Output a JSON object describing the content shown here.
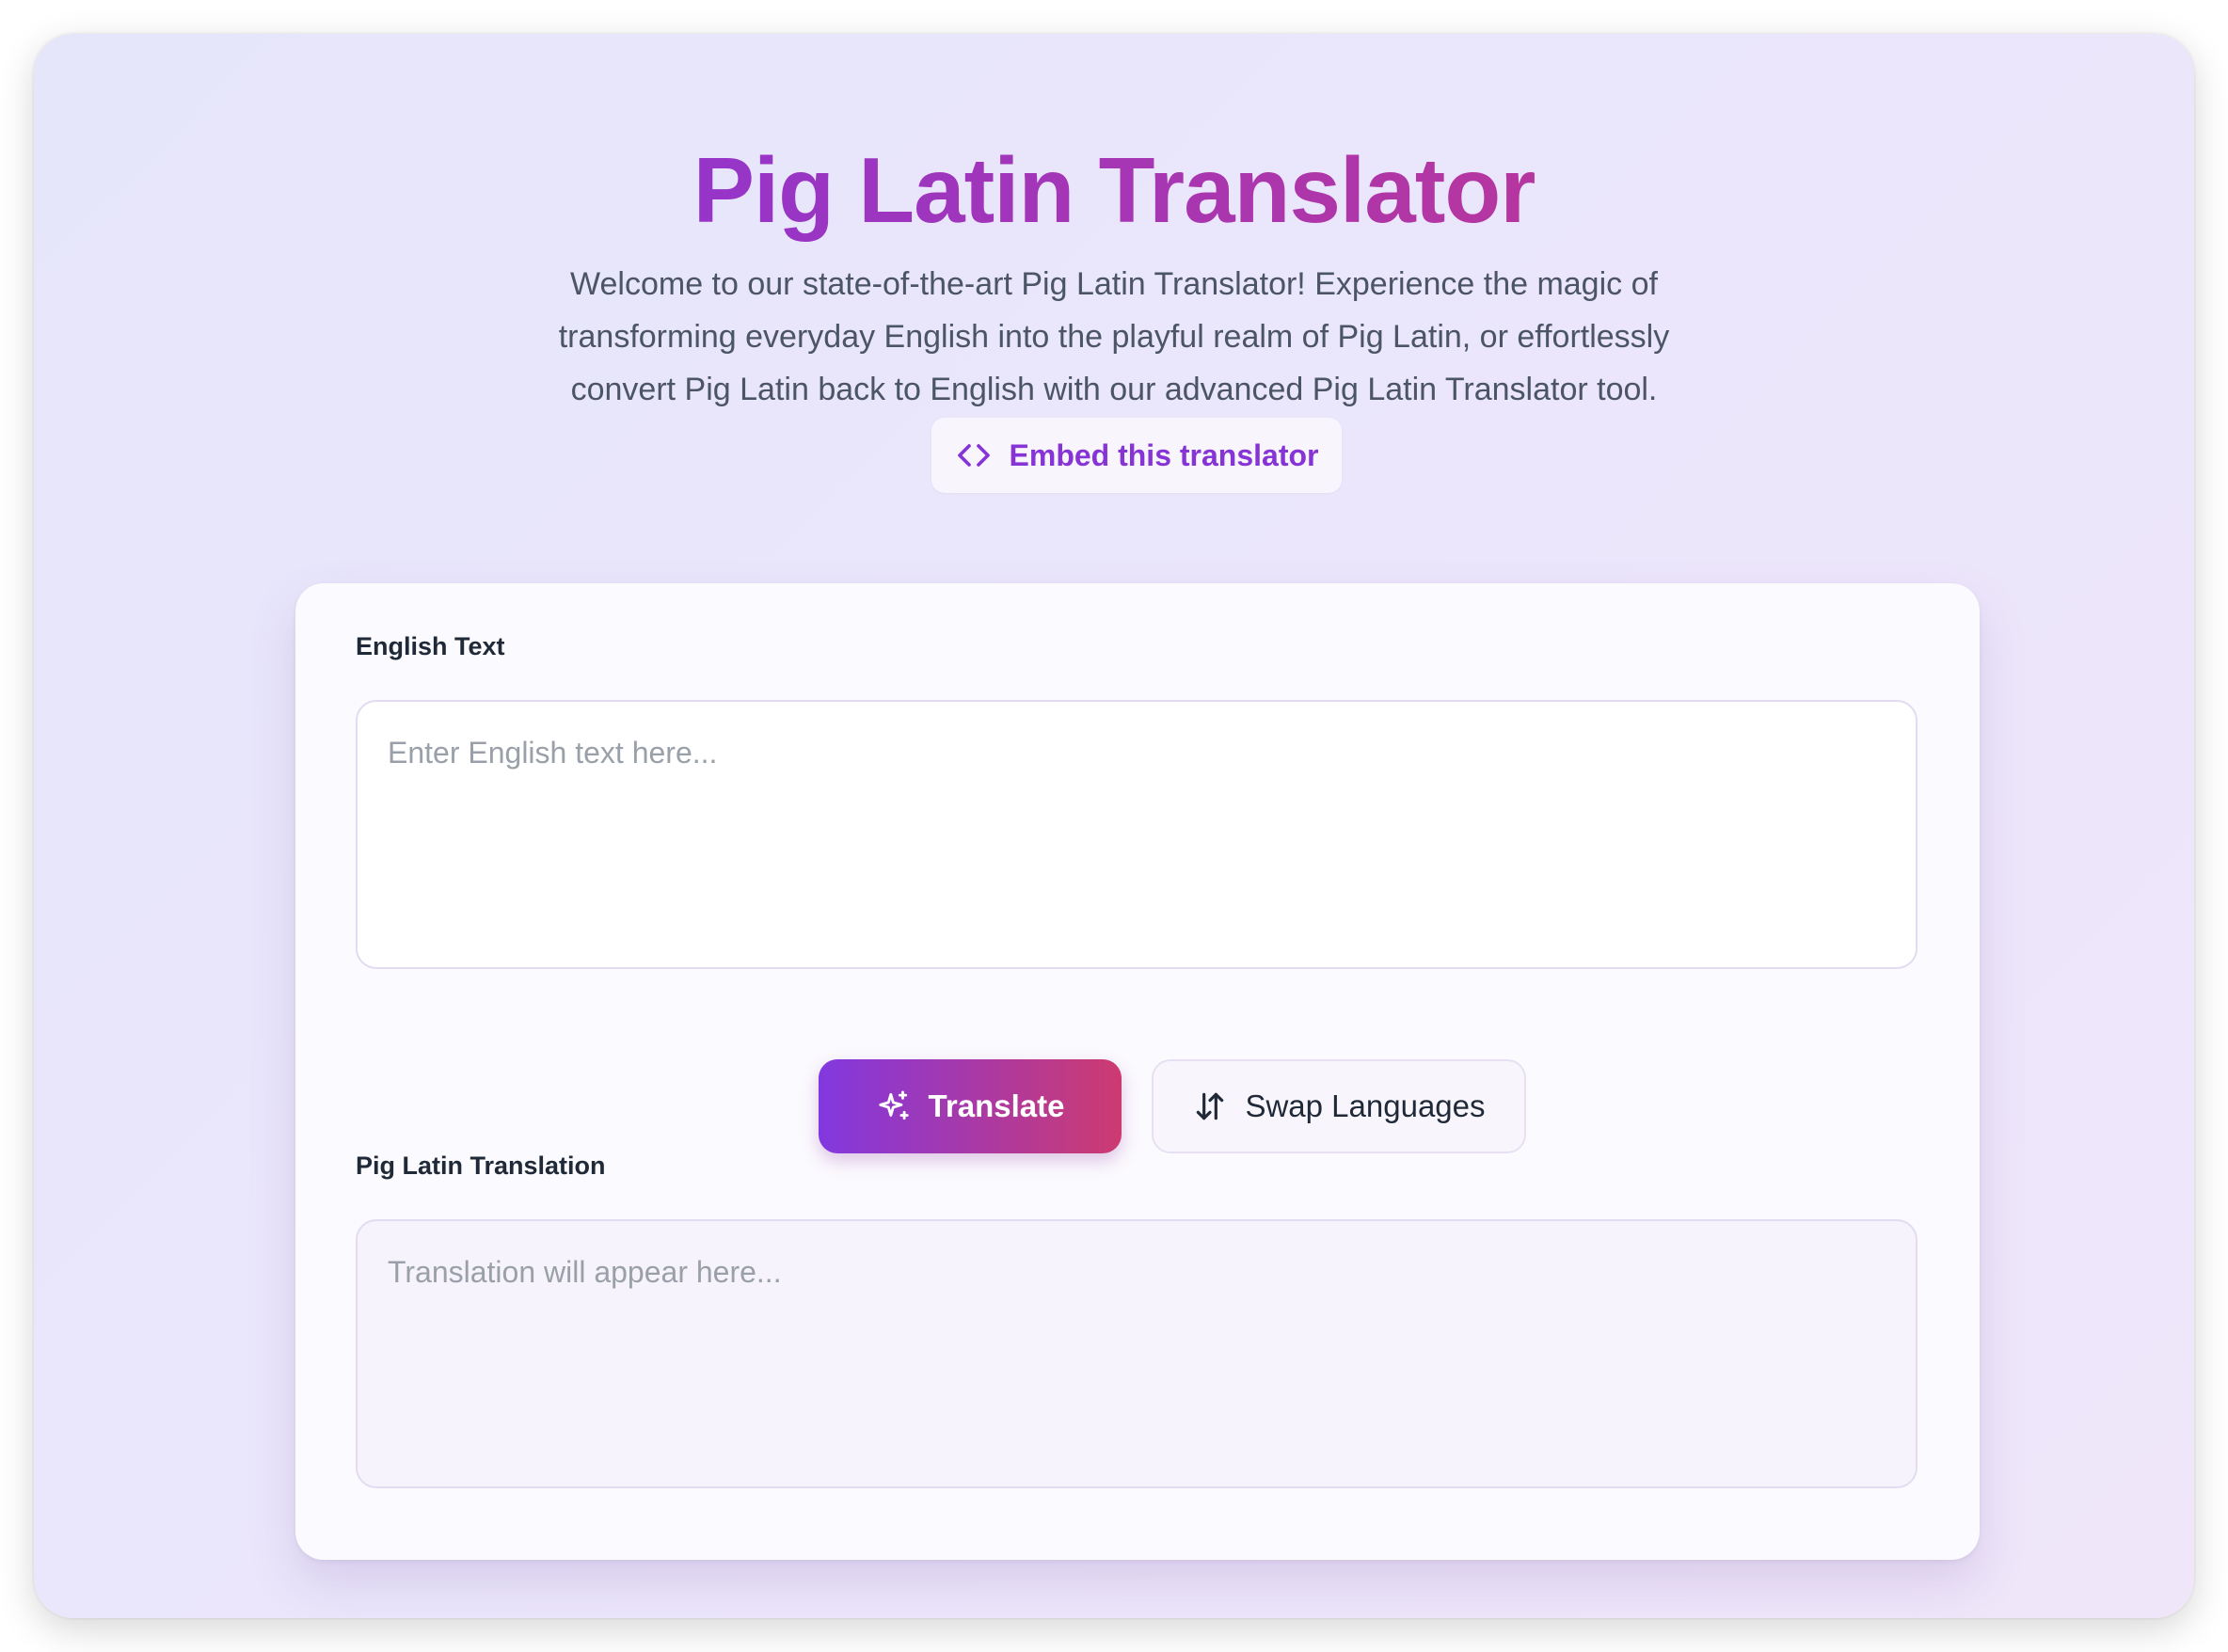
{
  "header": {
    "title": "Pig Latin Translator",
    "description": "Welcome to our state-of-the-art Pig Latin Translator! Experience the magic of transforming everyday English into the playful realm of Pig Latin, or effortlessly convert Pig Latin back to English with our advanced Pig Latin Translator tool.",
    "embed_label": "Embed this translator"
  },
  "translator": {
    "input": {
      "label": "English Text",
      "value": "",
      "placeholder": "Enter English text here..."
    },
    "actions": {
      "translate_label": "Translate",
      "swap_label": "Swap Languages"
    },
    "output": {
      "label": "Pig Latin Translation",
      "value": "",
      "placeholder": "Translation will appear here..."
    }
  },
  "icons": {
    "embed": "code-icon",
    "translate": "sparkles-icon",
    "swap": "arrow-up-down-icon"
  },
  "colors": {
    "accent": "#8634d6",
    "title_gradient_start": "#9535c9",
    "title_gradient_end": "#b6369f",
    "button_gradient_start": "#8238e0",
    "button_gradient_end": "#cd3a70"
  }
}
